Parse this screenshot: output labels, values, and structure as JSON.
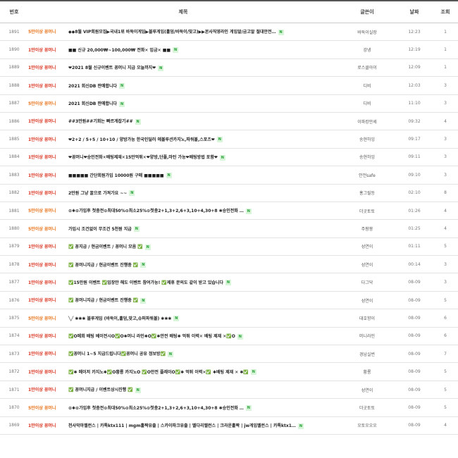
{
  "columns": {
    "no": "번호",
    "title": "제목",
    "author": "글쓴이",
    "date": "날짜",
    "views": "조회"
  },
  "new_badge": "N",
  "category_colors": {
    "5만이상 꽁머니": "#e8741c",
    "1만이상 꽁머니": "#d9321e"
  },
  "rows": [
    {
      "no": "1891",
      "category": "5만이상 꽁머니",
      "subject": "◆◆8월 VIP회원모집▶국내1위 바둑이게임▶블루게임(홀덤/바둑이/맞고)▶▶본사직영라인 게임알/금고알 절대안전…",
      "author": "바둑이실장",
      "date": "12:23",
      "views": "1"
    },
    {
      "no": "1890",
      "category": "1만이상 꽁머니",
      "subject": "■■ 신규 20,000₩~100,000₩ 전화✕ 입금✕ ■■",
      "author": "강냉",
      "date": "12:19",
      "views": "1"
    },
    {
      "no": "1889",
      "category": "1만이상 꽁머니",
      "subject": "❤2021 8월 신규이벤트 꽁머니 지급 오늘까지❤",
      "author": "로스클아이",
      "date": "12:09",
      "views": "1"
    },
    {
      "no": "1888",
      "category": "1만이상 꽁머니",
      "subject": "2021 회신DB 판매합니다",
      "author": "디비",
      "date": "12:03",
      "views": "3"
    },
    {
      "no": "1887",
      "category": "5만이상 꽁머니",
      "subject": "2021 회신DB 판매합니다",
      "author": "디비",
      "date": "11:10",
      "views": "3"
    },
    {
      "no": "1886",
      "category": "1만이상 꽁머니",
      "subject": "##3만원##기회는 빠르게잡기##",
      "author": "이파캉만세",
      "date": "09:32",
      "views": "4"
    },
    {
      "no": "1885",
      "category": "1만이상 꽁머니",
      "subject": "❤2+2 / 5+5 / 10+10 / 양방가능 한국인딜러 에볼루션카지노,파워볼,스포츠❤",
      "author": "송현하잉",
      "date": "09:17",
      "views": "3"
    },
    {
      "no": "1884",
      "category": "1만이상 꽁머니",
      "subject": "❤꽁머니❤승인전화✕배팅제재✕15만먹튀✕❤양방,단폴,마틴 가능❤배팅방법 포함❤",
      "author": "송현하잉",
      "date": "09:11",
      "views": "3"
    },
    {
      "no": "1883",
      "category": "1만이상 꽁머니",
      "subject": "■■■■■ 간단회원가입 10000원 구매 ■■■■■",
      "author": "안전safe",
      "date": "09:10",
      "views": "3"
    },
    {
      "no": "1882",
      "category": "1만이상 꽁머니",
      "subject": "2만원 그냥 꿀으로 가져가요 ~~",
      "author": "홍그릴등",
      "date": "02:10",
      "views": "8"
    },
    {
      "no": "1881",
      "category": "5만이상 꽁머니",
      "subject": "⊙✱⊙가입후 첫충전⊙최대50%⊙최소25%⊙첫충2+1,3+2,6+3,10+4,30+8 ✱승인전화 …",
      "author": "더굿토토",
      "date": "01:26",
      "views": "4"
    },
    {
      "no": "1880",
      "category": "5만이상 꽁머니",
      "subject": "가입시 조건없이 무조건 5천원 지급",
      "author": "주팡팡",
      "date": "01:25",
      "views": "4"
    },
    {
      "no": "1879",
      "category": "1만이상 꽁머니",
      "subject": "✅ 꽁지급 / 현금이벤트 / 꽁머니 모음 ✅",
      "author": "성연이",
      "date": "01:11",
      "views": "5"
    },
    {
      "no": "1878",
      "category": "1만이상 꽁머니",
      "subject": "✅ 꽁머니지급 / 현금이벤트 진행중 ✅",
      "author": "성연이",
      "date": "00:14",
      "views": "3"
    },
    {
      "no": "1877",
      "category": "1만이상 꽁머니",
      "subject": "✅15만원 이벤트 ✅입장만 해도 이벤트 참여가능! ✅제휴 문의도 같이 받고 있습니다",
      "author": "다그닥",
      "date": "08-09",
      "views": "3"
    },
    {
      "no": "1876",
      "category": "1만이상 꽁머니",
      "subject": "✅ 꽁머니지급 / 현금이벤트 진행중 ✅",
      "author": "성연이",
      "date": "08-09",
      "views": "5"
    },
    {
      "no": "1875",
      "category": "5만이상 꽁머니",
      "subject": "╲╱ ✱✱✱ 블루게임 (바둑이,홀덤,맞고,슈퍼파워볼) ✱✱✱",
      "author": "대호향이",
      "date": "08-09",
      "views": "6"
    },
    {
      "no": "1874",
      "category": "1만이상 꽁머니",
      "subject": "✅O메회 배팅 베이전시O✅O✱머니 라인✱O✅✱안전 배팅✱ 먹튀 이력✕ 배팅 제재 ✕✅O",
      "author": "머니라인",
      "date": "08-09",
      "views": "6"
    },
    {
      "no": "1873",
      "category": "1만이상 꽁머니",
      "subject": "✅꽁머니 1~5 지급드립니다✅꽁머니 공유 정보방✅",
      "author": "경남실번",
      "date": "08-09",
      "views": "7"
    },
    {
      "no": "1872",
      "category": "1만이상 꽁머니",
      "subject": "✅✱ 메이저 카지노✱✅O황룡 카지노O ✅O안전 플레이O✅✱ 먹튀 이력✕✅ ✱배팅 제재 ✕ ✱✅",
      "author": "황룡",
      "date": "08-09",
      "views": "5"
    },
    {
      "no": "1871",
      "category": "1만이상 꽁머니",
      "subject": "✅ 꽁머니지급 / 이벤트상시진행 ✅",
      "author": "성연이",
      "date": "08-09",
      "views": "5"
    },
    {
      "no": "1870",
      "category": "5만이상 꽁머니",
      "subject": "⊙✱⊙가입후 첫충전⊙최대50%⊙최소25%⊙첫충2+1,3+2,6+3,10+4,30+8 ✱승인전화 …",
      "author": "더굿토토",
      "date": "08-09",
      "views": "5"
    },
    {
      "no": "1869",
      "category": "1만이상 꽁머니",
      "subject": "천사막마벨런스 | 카톡ktx111 | mgm홀짝유출 | 스카이파크유출 | 벨다리벨런스 | 크라운홀짝 | jw게임벨런스 | 카톡ktx1…",
      "author": "오토오오오",
      "date": "08-09",
      "views": "4"
    }
  ]
}
